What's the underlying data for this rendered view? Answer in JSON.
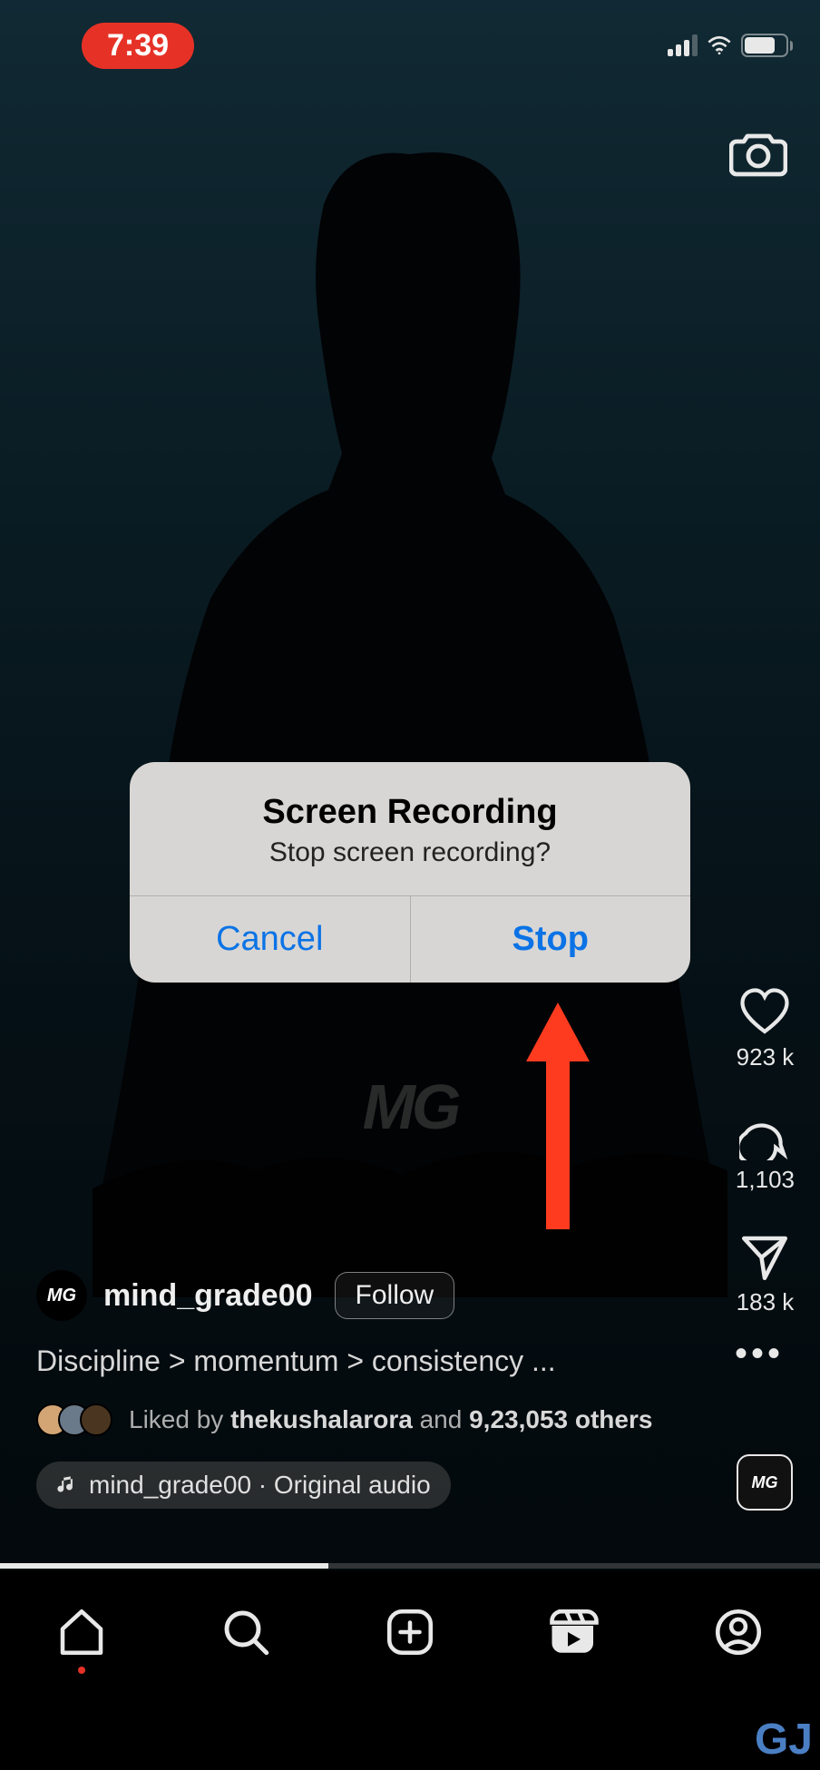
{
  "status": {
    "time": "7:39",
    "battery": "68"
  },
  "alert": {
    "title": "Screen Recording",
    "message": "Stop screen recording?",
    "cancel": "Cancel",
    "stop": "Stop"
  },
  "reel": {
    "username": "mind_grade00",
    "avatar_text": "MG",
    "follow_label": "Follow",
    "caption": "Discipline > momentum > consistency  ...",
    "likes_prefix": "Liked by ",
    "likes_user": "thekushalarora",
    "likes_mid": " and ",
    "likes_count": "9,23,053 others",
    "audio_label": "mind_grade00 · Original audio"
  },
  "actions": {
    "likes": "923 k",
    "comments": "1,103",
    "shares": "183 k"
  },
  "watermark": "MG",
  "icons": {
    "camera": "camera-icon",
    "heart": "heart-icon",
    "comment": "comment-icon",
    "share": "share-icon",
    "more": "more-icon",
    "home": "home-icon",
    "search": "search-icon",
    "add": "add-icon",
    "reels": "reels-icon",
    "profile": "profile-icon",
    "music": "music-icon"
  }
}
